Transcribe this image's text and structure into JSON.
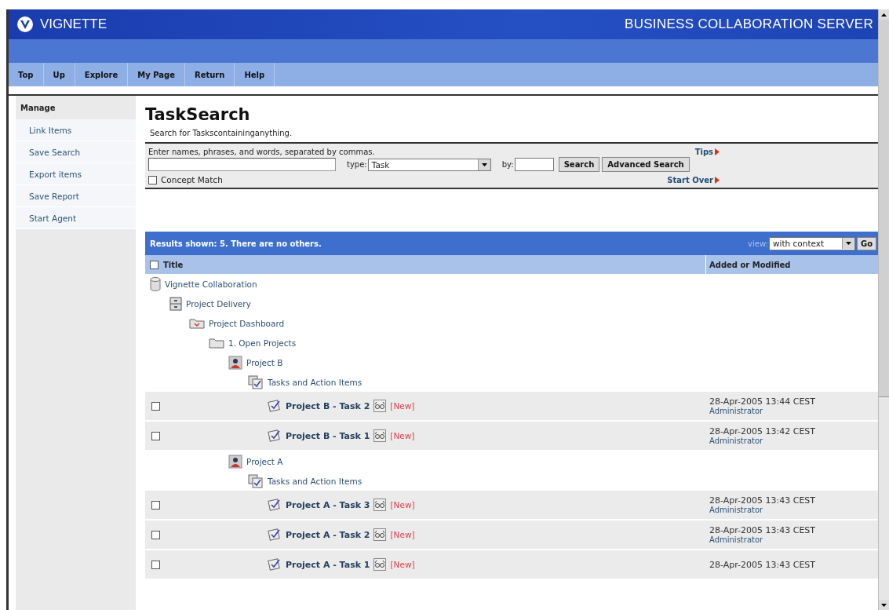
{
  "header": {
    "logo_text": "VIGNETTE",
    "product": "BUSINESS COLLABORATION SERVER"
  },
  "nav": [
    "Top",
    "Up",
    "Explore",
    "My Page",
    "Return",
    "Help"
  ],
  "sidebar": {
    "title": "Manage",
    "items": [
      "Link Items",
      "Save Search",
      "Export items",
      "Save Report",
      "Start Agent"
    ]
  },
  "page": {
    "title": "TaskSearch",
    "subtitle": "Search for Taskscontaininganything."
  },
  "search": {
    "instructions": "Enter names, phrases, and words, separated by commas.",
    "tips": "Tips",
    "type_label": "type:",
    "type_value": "Task",
    "by_label": "by:",
    "search_button": "Search",
    "advanced_button": "Advanced Search",
    "concept_match": {
      "label": "Concept Match",
      "checked": false
    },
    "start_over": "Start Over"
  },
  "results": {
    "summary": "Results shown: 5. There are no others.",
    "view_label": "view:",
    "view_value": "with context",
    "go_button": "Go"
  },
  "table": {
    "select_all_checked": false,
    "columns": [
      "Title",
      "Added or Modified"
    ]
  },
  "tree": [
    {
      "kind": "repository",
      "label": "Vignette Collaboration",
      "children": [
        {
          "kind": "cabinet",
          "label": "Project Delivery",
          "children": [
            {
              "kind": "dashboard",
              "label": "Project Dashboard",
              "children": [
                {
                  "kind": "folder",
                  "label": "1. Open Projects",
                  "children": [
                    {
                      "kind": "project",
                      "label": "Project B",
                      "children": [
                        {
                          "kind": "tasklist",
                          "label": "Tasks and Action Items",
                          "children": [
                            {
                              "kind": "task",
                              "label": "Project B - Task 2",
                              "badge": "[New]",
                              "checked": false,
                              "modified": "28-Apr-2005 13:44 CEST",
                              "author": "Administrator"
                            },
                            {
                              "kind": "task",
                              "label": "Project B - Task 1",
                              "badge": "[New]",
                              "checked": false,
                              "modified": "28-Apr-2005 13:42 CEST",
                              "author": "Administrator"
                            }
                          ]
                        }
                      ]
                    },
                    {
                      "kind": "project",
                      "label": "Project A",
                      "children": [
                        {
                          "kind": "tasklist",
                          "label": "Tasks and Action Items",
                          "children": [
                            {
                              "kind": "task",
                              "label": "Project A - Task 3",
                              "badge": "[New]",
                              "checked": false,
                              "modified": "28-Apr-2005 13:43 CEST",
                              "author": "Administrator"
                            },
                            {
                              "kind": "task",
                              "label": "Project A - Task 2",
                              "badge": "[New]",
                              "checked": false,
                              "modified": "28-Apr-2005 13:43 CEST",
                              "author": "Administrator"
                            },
                            {
                              "kind": "task",
                              "label": "Project A - Task 1",
                              "badge": "[New]",
                              "checked": false,
                              "modified": "28-Apr-2005 13:43 CEST"
                            }
                          ]
                        }
                      ]
                    }
                  ]
                }
              ]
            }
          ]
        }
      ]
    }
  ]
}
